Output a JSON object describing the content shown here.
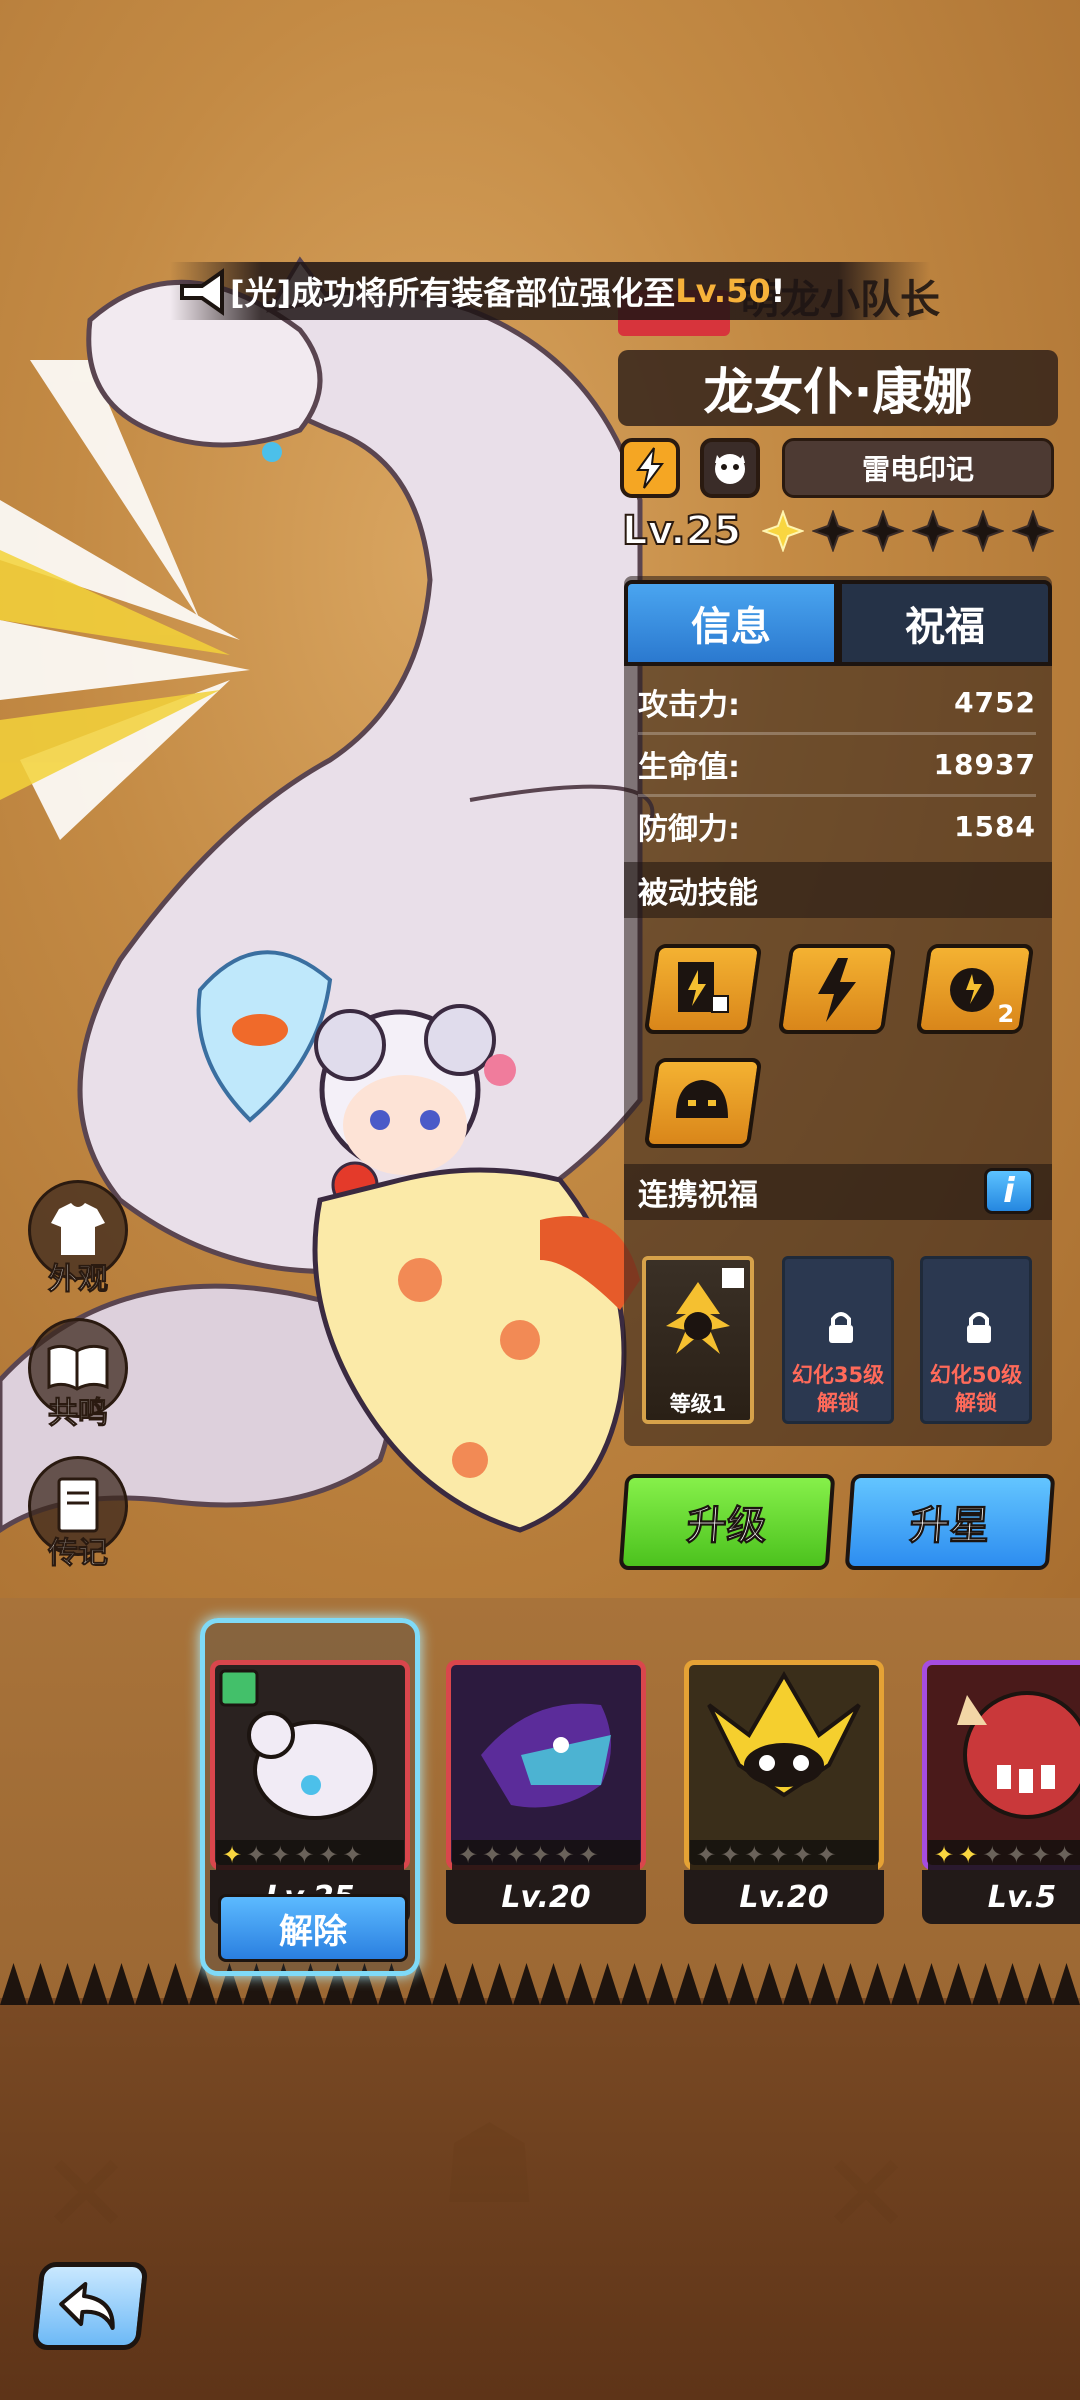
{
  "notice": {
    "prefix": "[光]成功将所有装备部位强化至",
    "highlight": "Lv.50",
    "suffix": "!"
  },
  "hero": {
    "subtitle": "萌龙小队长",
    "name": "龙女仆·康娜",
    "element_icon": "lightning-icon",
    "class_icon": "beast-face-icon",
    "seal": "雷电印记",
    "level": "Lv.25",
    "stars_total": 6,
    "stars_filled": 1
  },
  "tabs": {
    "info": "信息",
    "bless": "祝福"
  },
  "stats": [
    {
      "label": "攻击力:",
      "value": "4752"
    },
    {
      "label": "生命值:",
      "value": "18937"
    },
    {
      "label": "防御力:",
      "value": "1584"
    }
  ],
  "passive": {
    "title": "被动技能",
    "skill3_badge": "2"
  },
  "link_bless": {
    "title": "连携祝福",
    "info_label": "i",
    "cards": [
      {
        "caption": "等级1"
      },
      {
        "line1": "幻化35级",
        "line2": "解锁"
      },
      {
        "line1": "幻化50级",
        "line2": "解锁"
      }
    ]
  },
  "actions": {
    "upgrade": "升级",
    "star_up": "升星"
  },
  "side_menu": {
    "appearance": "外观",
    "resonance": "共鸣",
    "biography": "传记"
  },
  "roster": [
    {
      "level": "Lv.25",
      "stars": 1,
      "frame": "#d9464c",
      "release": "解除"
    },
    {
      "level": "Lv.20",
      "stars": 0,
      "frame": "#d9464c"
    },
    {
      "level": "Lv.20",
      "stars": 0,
      "frame": "#e5a235"
    },
    {
      "level": "Lv.5",
      "stars": 2,
      "frame": "#a54de0"
    }
  ],
  "colors": {
    "accent_blue": "#2b79cf",
    "accent_green": "#4cc21e",
    "gold": "#f6b23a",
    "panel": "#253247"
  }
}
